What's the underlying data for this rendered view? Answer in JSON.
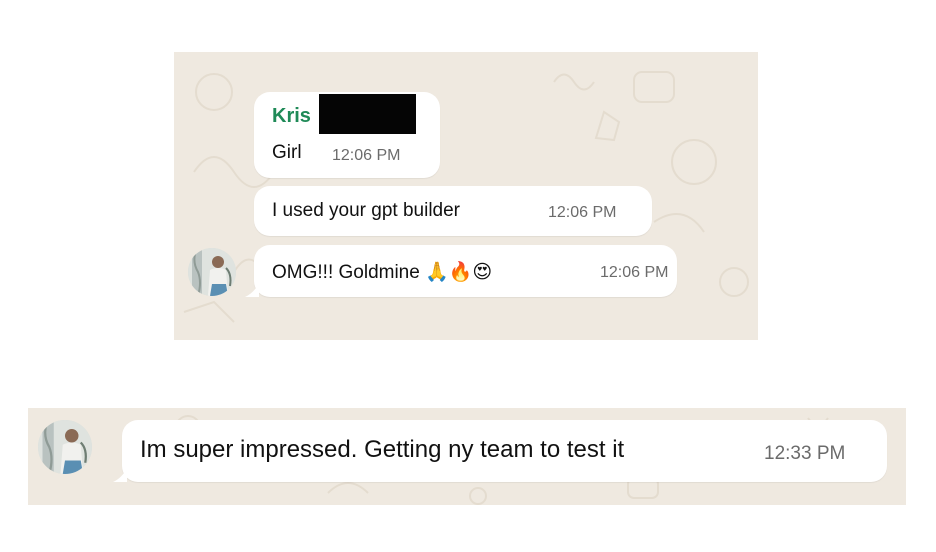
{
  "conversation_top": {
    "message_1": {
      "sender": "Kris",
      "text": "Girl",
      "time": "12:06 PM"
    },
    "message_2": {
      "text": "I used your gpt builder",
      "time": "12:06 PM"
    },
    "message_3": {
      "text": "OMG!!! Goldmine",
      "emojis": "🙏🔥😍",
      "time": "12:06 PM"
    }
  },
  "conversation_bottom": {
    "message_4": {
      "text": "Im super impressed. Getting ny team to test it",
      "time": "12:33 PM"
    }
  },
  "colors": {
    "chat_background": "#efe9e0",
    "bubble": "#ffffff",
    "sender_name": "#1f8a57",
    "timestamp": "#6b6b6b"
  },
  "icons": [
    "contact-avatar"
  ]
}
